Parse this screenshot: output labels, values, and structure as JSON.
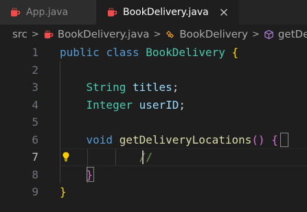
{
  "tabs": [
    {
      "label": "App.java",
      "active": false,
      "icon": "java-coffee-icon"
    },
    {
      "label": "BookDelivery.java",
      "active": true,
      "icon": "java-coffee-icon"
    }
  ],
  "breadcrumb": {
    "root": "src",
    "file": "BookDelivery.java",
    "class": "BookDelivery",
    "method": "getDelivery"
  },
  "editor": {
    "active_line": 7,
    "line_numbers": [
      "1",
      "2",
      "3",
      "4",
      "5",
      "6",
      "7",
      "8",
      "9"
    ],
    "tokens": {
      "l1_public": "public",
      "l1_class": "class",
      "l1_name": "BookDelivery",
      "l1_brace": "{",
      "l3_type": "String",
      "l3_var": "titles",
      "l3_semi": ";",
      "l4_type": "Integer",
      "l4_var": "userID",
      "l4_semi": ";",
      "l6_void": "void",
      "l6_fn": "getDeliveryLocations",
      "l6_parens": "()",
      "l6_brace": "{",
      "l7_comment": "//",
      "l8_brace": "}",
      "l9_brace": "}"
    }
  },
  "colors": {
    "keyword": "#569cd6",
    "type": "#4ec9b0",
    "function": "#dcdcaa",
    "variable": "#9cdcfe",
    "comment": "#6a9955",
    "java_icon": "#f14c4c"
  }
}
